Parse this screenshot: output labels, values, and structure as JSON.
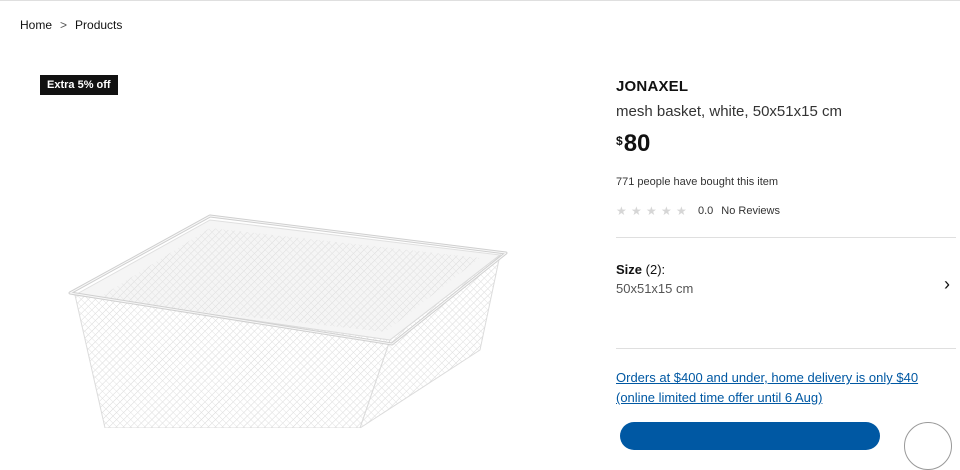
{
  "breadcrumb": {
    "items": [
      "Home",
      "Products"
    ],
    "separator": ">"
  },
  "badge": {
    "label": "Extra 5% off"
  },
  "product": {
    "name": "JONAXEL",
    "description": "mesh basket, white, 50x51x15 cm",
    "price_currency": "$",
    "price_amount": "80",
    "bought_text": "771 people have bought this item",
    "rating_score": "0.0",
    "rating_text": "No Reviews",
    "rating_stars_filled": 0,
    "rating_stars_total": 5,
    "image_icon": "mesh-basket-image"
  },
  "size": {
    "label": "Size",
    "count": "(2):",
    "value": "50x51x15 cm",
    "chevron_icon": "chevron-right-icon"
  },
  "promo": {
    "line1": "Orders at $400 and under, home delivery is only $40",
    "line2": "(online limited time offer until 6 Aug)"
  },
  "colors": {
    "accent": "#0058a3",
    "badge_bg": "#111111",
    "divider": "#dfdfdf"
  }
}
